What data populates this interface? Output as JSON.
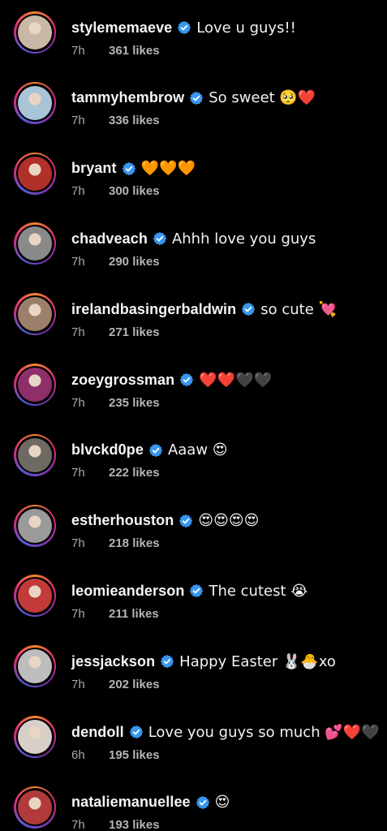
{
  "comments": [
    {
      "username": "stylememaeve",
      "comment": "Love u guys!!",
      "time": "7h",
      "likes": "361 likes",
      "avatar_color": "#c9b8a6"
    },
    {
      "username": "tammyhembrow",
      "comment": "So sweet 🥺❤️",
      "time": "7h",
      "likes": "336 likes",
      "avatar_color": "#a9c4d6"
    },
    {
      "username": "bryant",
      "comment": "🧡🧡🧡",
      "time": "7h",
      "likes": "300 likes",
      "avatar_color": "#b0302a"
    },
    {
      "username": "chadveach",
      "comment": "Ahhh love you guys",
      "time": "7h",
      "likes": "290 likes",
      "avatar_color": "#8a8a8a"
    },
    {
      "username": "irelandbasingerbaldwin",
      "comment": "so cute 💘",
      "time": "7h",
      "likes": "271 likes",
      "avatar_color": "#9c7f6b"
    },
    {
      "username": "zoeygrossman",
      "comment": "❤️❤️🖤🖤",
      "time": "7h",
      "likes": "235 likes",
      "avatar_color": "#8e2f6a"
    },
    {
      "username": "blvckd0pe",
      "comment": "Aaaw 😍",
      "time": "7h",
      "likes": "222 likes",
      "avatar_color": "#6e6a63"
    },
    {
      "username": "estherhouston",
      "comment": "😍😍😍😍",
      "time": "7h",
      "likes": "218 likes",
      "avatar_color": "#9a9a9a"
    },
    {
      "username": "leomieanderson",
      "comment": "The cutest 😭",
      "time": "7h",
      "likes": "211 likes",
      "avatar_color": "#c23a3a"
    },
    {
      "username": "jessjackson",
      "comment": "Happy Easter 🐰🐣xo",
      "time": "7h",
      "likes": "202 likes",
      "avatar_color": "#bdbdbd"
    },
    {
      "username": "dendoll",
      "comment": "Love you guys so much 💕❤️🖤",
      "time": "6h",
      "likes": "195 likes",
      "avatar_color": "#d8cfc8"
    },
    {
      "username": "nataliemanuellee",
      "comment": "😍",
      "time": "7h",
      "likes": "193 likes",
      "avatar_color": "#b23a3a"
    }
  ],
  "verified_color": "#3897f0"
}
